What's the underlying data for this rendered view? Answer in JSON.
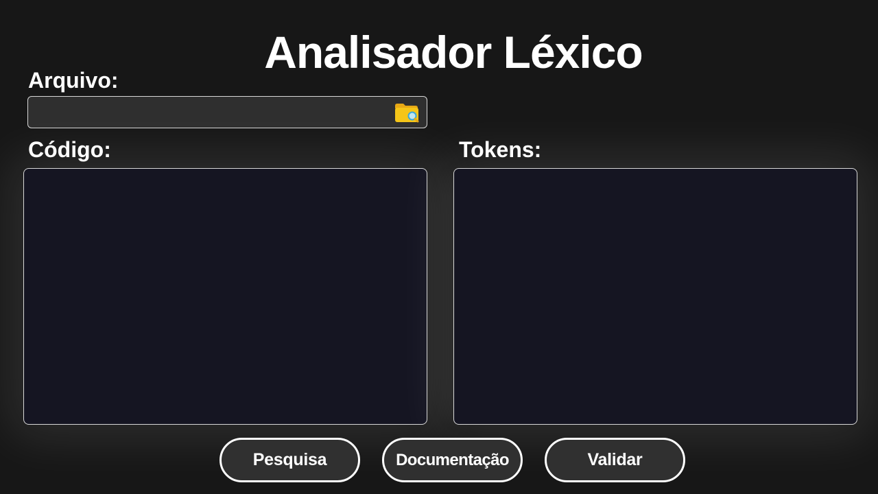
{
  "header": {
    "title": "Analisador Léxico"
  },
  "file": {
    "label": "Arquivo:",
    "value": "",
    "placeholder": "",
    "icon": "folder-search-icon"
  },
  "code": {
    "label": "Código:",
    "value": ""
  },
  "tokens": {
    "label": "Tokens:",
    "value": ""
  },
  "actions": {
    "search_label": "Pesquisa",
    "docs_label": "Documentação",
    "validate_label": "Validar"
  },
  "colors": {
    "background": "#171717",
    "editor_background": "#151522",
    "field_background": "#2f2f2f",
    "button_background": "#303030",
    "border": "#ffffff",
    "icon_folder": "#f5c518",
    "icon_magnifier": "#3aa7d8"
  }
}
